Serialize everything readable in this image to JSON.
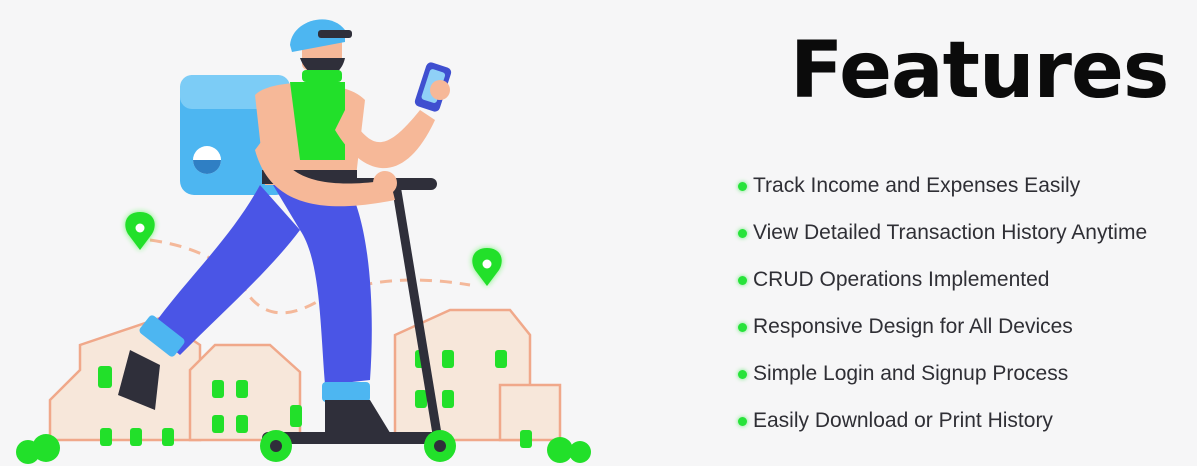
{
  "title": "Features",
  "features": [
    "Track Income and Expenses Easily",
    "View Detailed Transaction History Anytime",
    "CRUD Operations Implemented",
    "Responsive Design for All Devices",
    "Simple Login and Signup Process",
    "Easily Download or Print History"
  ],
  "colors": {
    "bullet": "#27e33a",
    "highlight_green": "#22f024",
    "title": "#0b0b0b",
    "text": "#2f2f35",
    "background": "#f6f6f7"
  },
  "illustration": {
    "subject": "delivery-courier-on-scooter",
    "icons": [
      "location-pin-icon",
      "location-pin-icon",
      "phone-icon",
      "backpack-icon"
    ]
  }
}
